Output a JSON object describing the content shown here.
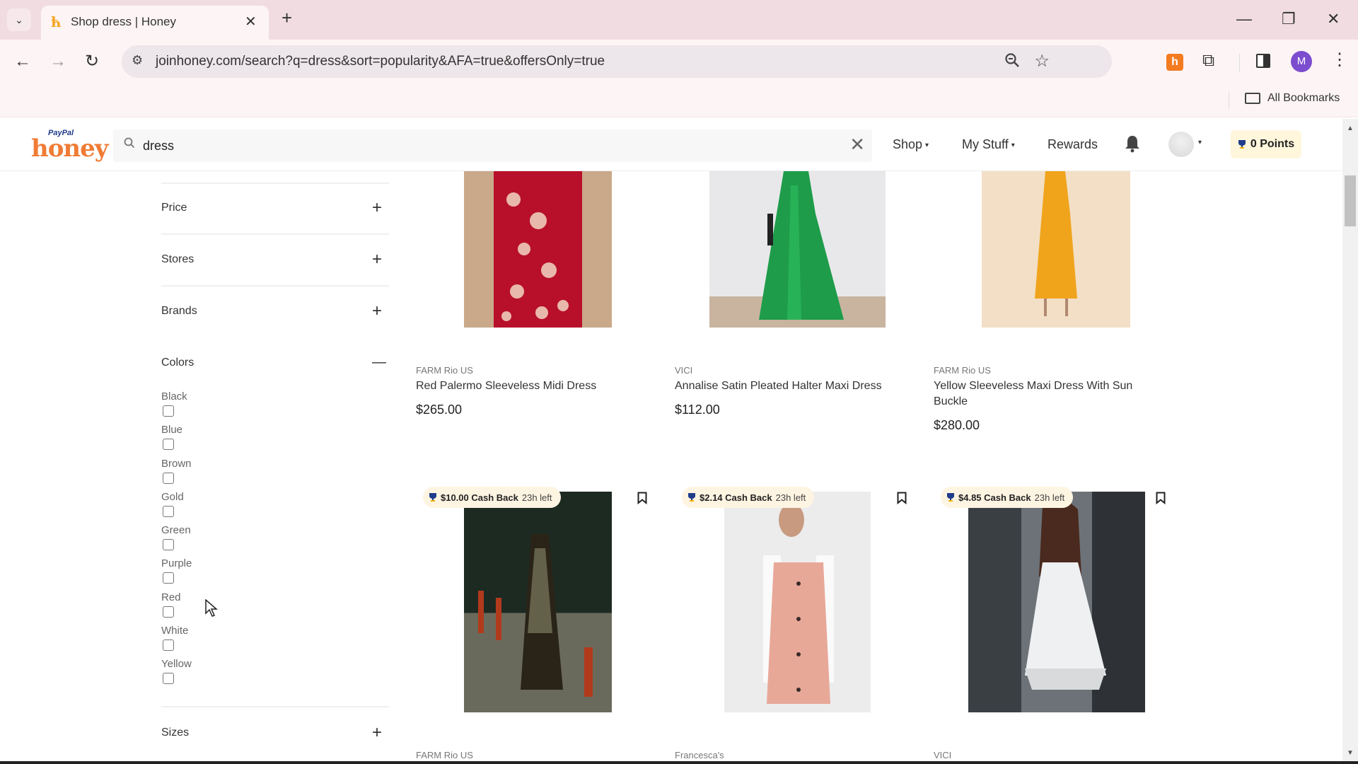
{
  "browser": {
    "tab_title": "Shop dress | Honey",
    "url": "joinhoney.com/search?q=dress&sort=popularity&AFA=true&offersOnly=true",
    "profile_initial": "M",
    "bookmarks_label": "All Bookmarks",
    "icons": {
      "tab_dropdown": "⌄",
      "favicon": "ћ",
      "tab_close": "✕",
      "new_tab": "+",
      "minimize": "—",
      "restore": "❐",
      "close": "✕",
      "back": "←",
      "forward": "→",
      "reload": "↻",
      "site_info": "⚙",
      "zoom": "🔍",
      "star": "☆",
      "extensions": "⧉",
      "menu": "⋮",
      "honey_ext": "h"
    }
  },
  "header": {
    "logo_top": "PayPal",
    "logo_main": "honey",
    "search_value": "dress",
    "search_icon": "⚲",
    "clear_icon": "✕",
    "nav": {
      "shop": "Shop",
      "my_stuff": "My Stuff",
      "rewards": "Rewards"
    },
    "caret": "▾",
    "points_label": "0 Points"
  },
  "sidebar": {
    "filters": [
      {
        "label": "Price",
        "toggle": "+"
      },
      {
        "label": "Stores",
        "toggle": "+"
      },
      {
        "label": "Brands",
        "toggle": "+"
      },
      {
        "label": "Colors",
        "toggle": "—"
      },
      {
        "label": "Sizes",
        "toggle": "+"
      }
    ],
    "colors": [
      {
        "label": "Black",
        "checked": false
      },
      {
        "label": "Blue",
        "checked": false
      },
      {
        "label": "Brown",
        "checked": false
      },
      {
        "label": "Gold",
        "checked": false
      },
      {
        "label": "Green",
        "checked": false
      },
      {
        "label": "Purple",
        "checked": false
      },
      {
        "label": "Red",
        "checked": false
      },
      {
        "label": "White",
        "checked": false
      },
      {
        "label": "Yellow",
        "checked": false
      }
    ]
  },
  "products": {
    "row1": [
      {
        "brand": "FARM Rio US",
        "name": "Red Palermo Sleeveless Midi Dress",
        "price": "$265.00"
      },
      {
        "brand": "VICI",
        "name": "Annalise Satin Pleated Halter Maxi Dress",
        "price": "$112.00"
      },
      {
        "brand": "FARM Rio US",
        "name": "Yellow Sleeveless Maxi Dress With Sun Buckle",
        "price": "$280.00"
      }
    ],
    "row2": [
      {
        "brand": "FARM Rio US",
        "cashback": "$10.00 Cash Back",
        "time_left": "23h left"
      },
      {
        "brand": "Francesca's",
        "cashback": "$2.14 Cash Back",
        "time_left": "23h left"
      },
      {
        "brand": "VICI",
        "cashback": "$4.85 Cash Back",
        "time_left": "23h left"
      }
    ]
  },
  "colors": {
    "honey_orange": "#f07b34",
    "tab_bar": "#f1dde1",
    "badge_bg": "#fef4e2",
    "trophy_gold": "#f5b400",
    "trophy_navy": "#1f3c8a"
  }
}
